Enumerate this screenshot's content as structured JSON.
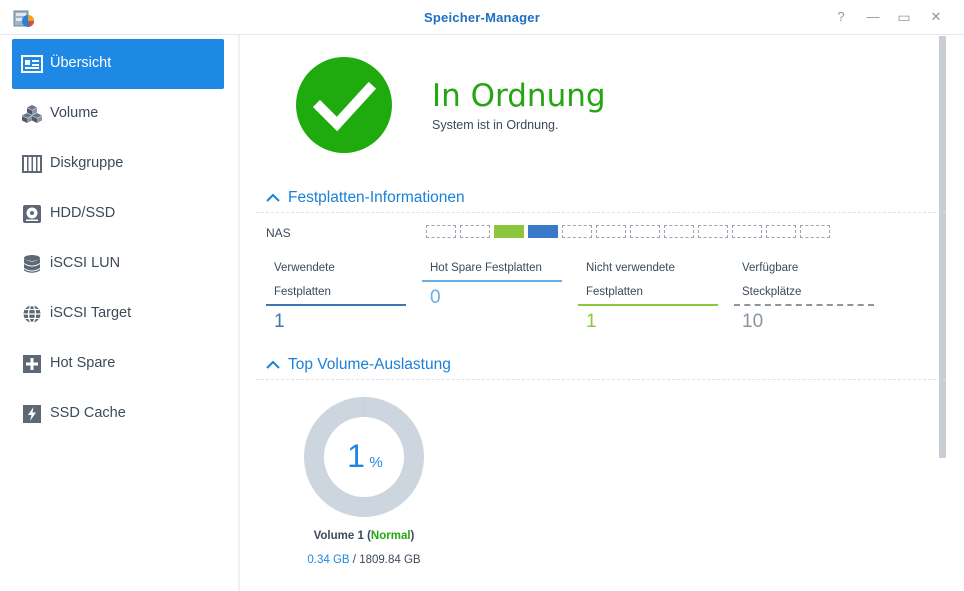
{
  "window": {
    "title": "Speicher-Manager",
    "help_glyph": "?",
    "minimize_glyph": "—",
    "maximize_glyph": "▭",
    "close_glyph": "✕"
  },
  "sidebar": {
    "items": [
      {
        "label": "Übersicht",
        "icon": "overview-icon",
        "active": true
      },
      {
        "label": "Volume",
        "icon": "cubes-icon"
      },
      {
        "label": "Diskgruppe",
        "icon": "disk-group-icon"
      },
      {
        "label": "HDD/SSD",
        "icon": "hdd-icon"
      },
      {
        "label": "iSCSI LUN",
        "icon": "database-icon"
      },
      {
        "label": "iSCSI Target",
        "icon": "globe-icon"
      },
      {
        "label": "Hot Spare",
        "icon": "plus-box-icon"
      },
      {
        "label": "SSD Cache",
        "icon": "lightning-icon"
      }
    ]
  },
  "status": {
    "title": "In Ordnung",
    "subtitle": "System ist in Ordnung.",
    "color": "#1fab0e"
  },
  "disk_info": {
    "header": "Festplatten-Informationen",
    "device_label": "NAS",
    "slots": [
      "empty",
      "empty",
      "green",
      "blue",
      "empty",
      "empty",
      "empty",
      "empty",
      "empty",
      "empty",
      "empty",
      "empty"
    ],
    "stats": [
      {
        "label_line1": "Verwendete",
        "label_line2": "Festplatten",
        "value": "1",
        "color": "#3a78b5"
      },
      {
        "label_line1": "Hot Spare Festplatten",
        "label_line2": "",
        "value": "0",
        "color": "#6aaee8"
      },
      {
        "label_line1": "Nicht verwendete",
        "label_line2": "Festplatten",
        "value": "1",
        "color": "#8cc63f"
      },
      {
        "label_line1": "Verfügbare",
        "label_line2": "Steckplätze",
        "value": "10",
        "color": "#8d969f"
      }
    ]
  },
  "volume_usage": {
    "header": "Top Volume-Auslastung",
    "percent_value": "1",
    "percent_sign": "%",
    "usage_fraction": 0.0002,
    "volume_name": "Volume 1",
    "paren_open": "(",
    "volume_status": "Normal",
    "paren_close": ")",
    "used": "0.34 GB",
    "separator": " / ",
    "total": "1809.84 GB"
  }
}
